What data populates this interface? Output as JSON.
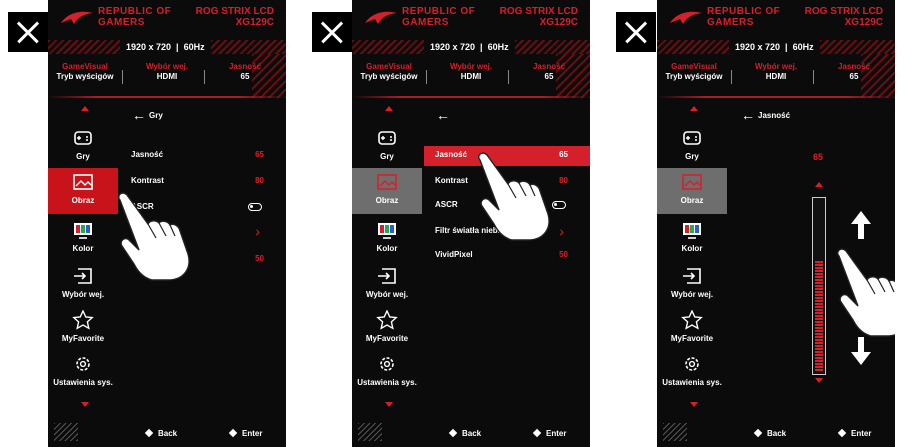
{
  "colors": {
    "accent": "#d4202a",
    "panel_bg": "#0b0b0b",
    "selected_grey": "#6e6e6e"
  },
  "header": {
    "brand_line1": "REPUBLIC OF",
    "brand_line2": "GAMERS",
    "model_line1": "ROG STRIX LCD",
    "model_line2": "XG129C"
  },
  "info": {
    "resolution": "1920 x 720",
    "refresh": "60Hz"
  },
  "status": [
    {
      "key": "GameVisual",
      "value": "Tryb wyścigów"
    },
    {
      "key": "Wybór wej.",
      "value": "HDMI"
    },
    {
      "key": "Jasność",
      "value": "65"
    }
  ],
  "nav": [
    {
      "label": "Gry",
      "icon": "gamepad-icon"
    },
    {
      "label": "Obraz",
      "icon": "image-icon"
    },
    {
      "label": "Kolor",
      "icon": "color-monitor-icon"
    },
    {
      "label": "Wybór wej.",
      "icon": "input-select-icon"
    },
    {
      "label": "MyFavorite",
      "icon": "star-icon"
    },
    {
      "label": "Ustawienia sys.",
      "icon": "gear-icon"
    }
  ],
  "panel1": {
    "breadcrumb": "Gry",
    "rows": [
      {
        "label": "Jasność",
        "value": "65"
      },
      {
        "label": "Kontrast",
        "value": "80"
      },
      {
        "label": "ASCR",
        "value": ""
      },
      {
        "label": "",
        "value": ""
      },
      {
        "label": "",
        "value": "50"
      }
    ]
  },
  "panel2": {
    "breadcrumb": "",
    "rows": [
      {
        "label": "Jasność",
        "value": "65"
      },
      {
        "label": "Kontrast",
        "value": "80"
      },
      {
        "label": "ASCR",
        "value": ""
      },
      {
        "label": "Filtr światła nieb.",
        "value": ""
      },
      {
        "label": "VividPixel",
        "value": "50"
      }
    ]
  },
  "panel3": {
    "breadcrumb": "Jasność",
    "slider_value": "65",
    "slider_level_percent": 65
  },
  "footer": {
    "back": "Back",
    "enter": "Enter"
  }
}
